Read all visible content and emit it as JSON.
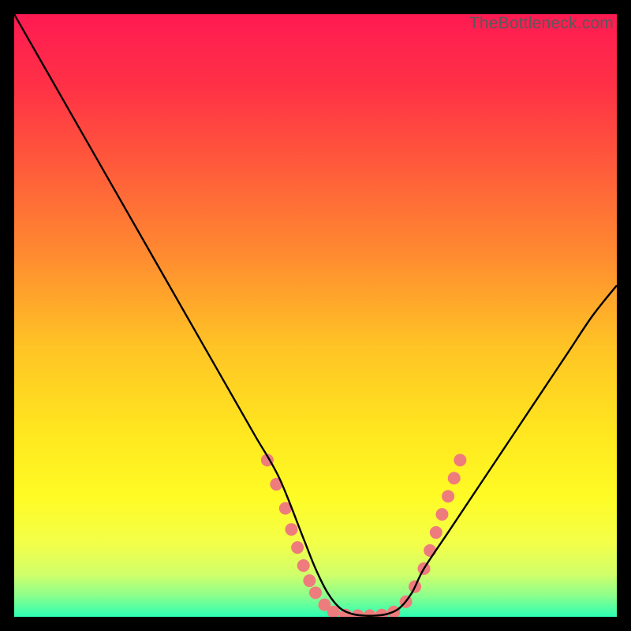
{
  "watermark": "TheBottleneck.com",
  "chart_data": {
    "type": "line",
    "title": "",
    "xlabel": "",
    "ylabel": "",
    "xlim": [
      0,
      100
    ],
    "ylim": [
      0,
      100
    ],
    "background_gradient": {
      "stops": [
        {
          "offset": 0.0,
          "color": "#ff1a52"
        },
        {
          "offset": 0.12,
          "color": "#ff3146"
        },
        {
          "offset": 0.25,
          "color": "#ff5a3b"
        },
        {
          "offset": 0.4,
          "color": "#ff8b30"
        },
        {
          "offset": 0.55,
          "color": "#ffc325"
        },
        {
          "offset": 0.7,
          "color": "#ffe81f"
        },
        {
          "offset": 0.8,
          "color": "#fffb25"
        },
        {
          "offset": 0.88,
          "color": "#f2ff4a"
        },
        {
          "offset": 0.93,
          "color": "#d0ff6a"
        },
        {
          "offset": 0.965,
          "color": "#8cff8c"
        },
        {
          "offset": 1.0,
          "color": "#2cffb3"
        }
      ]
    },
    "series": [
      {
        "name": "bottleneck-curve",
        "color": "#000000",
        "x": [
          0,
          4,
          8,
          12,
          16,
          20,
          24,
          28,
          32,
          36,
          40,
          44,
          48,
          50,
          52,
          54,
          56,
          58,
          60,
          62,
          64,
          66,
          68,
          72,
          76,
          80,
          84,
          88,
          92,
          96,
          100
        ],
        "y": [
          100,
          93,
          86,
          79,
          72,
          65,
          58,
          51,
          44,
          37,
          30,
          23,
          13,
          8,
          4,
          1.5,
          0.5,
          0.2,
          0.2,
          0.5,
          1.5,
          4,
          8,
          14,
          20,
          26,
          32,
          38,
          44,
          50,
          55
        ]
      }
    ],
    "markers": {
      "name": "highlight-dots",
      "color": "#ef7c7c",
      "radius": 8,
      "points": [
        {
          "x": 42.0,
          "y": 26.0
        },
        {
          "x": 43.5,
          "y": 22.0
        },
        {
          "x": 45.0,
          "y": 18.0
        },
        {
          "x": 46.0,
          "y": 14.5
        },
        {
          "x": 47.0,
          "y": 11.5
        },
        {
          "x": 48.0,
          "y": 8.5
        },
        {
          "x": 49.0,
          "y": 6.0
        },
        {
          "x": 50.0,
          "y": 4.0
        },
        {
          "x": 51.5,
          "y": 2.0
        },
        {
          "x": 53.0,
          "y": 0.8
        },
        {
          "x": 55.0,
          "y": 0.3
        },
        {
          "x": 57.0,
          "y": 0.2
        },
        {
          "x": 59.0,
          "y": 0.2
        },
        {
          "x": 61.0,
          "y": 0.3
        },
        {
          "x": 63.0,
          "y": 0.8
        },
        {
          "x": 65.0,
          "y": 2.5
        },
        {
          "x": 66.5,
          "y": 5.0
        },
        {
          "x": 68.0,
          "y": 8.0
        },
        {
          "x": 69.0,
          "y": 11.0
        },
        {
          "x": 70.0,
          "y": 14.0
        },
        {
          "x": 71.0,
          "y": 17.0
        },
        {
          "x": 72.0,
          "y": 20.0
        },
        {
          "x": 73.0,
          "y": 23.0
        },
        {
          "x": 74.0,
          "y": 26.0
        }
      ]
    }
  }
}
